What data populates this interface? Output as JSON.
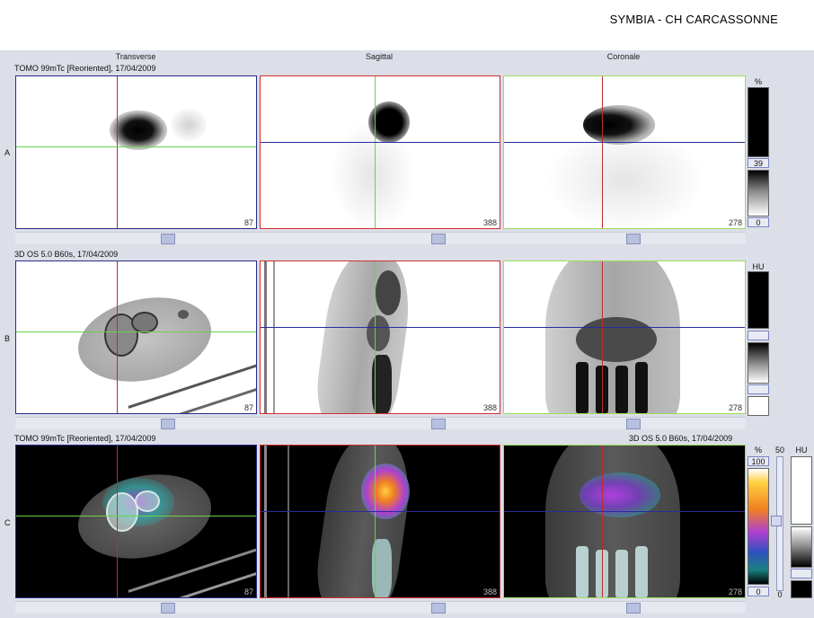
{
  "header": {
    "title": "SYMBIA - CH CARCASSONNE"
  },
  "columns": {
    "transverse": "Transverse",
    "sagittal": "Sagittal",
    "coronal": "Coronale"
  },
  "rows": {
    "a": {
      "letter": "A",
      "series": "TOMO 99mTc [Reoriented], 17/04/2009",
      "scale_unit": "%",
      "scale_max": "39",
      "scale_min": "0"
    },
    "b": {
      "letter": "B",
      "series": "3D  OS  5.0  B60s, 17/04/2009",
      "scale_unit": "HU"
    },
    "c": {
      "letter": "C",
      "series_left": "TOMO 99mTc [Reoriented], 17/04/2009",
      "series_right": "3D  OS  5.0  B60s, 17/04/2009",
      "scale_unit_pct": "%",
      "scale_max_pct": "100",
      "scale_min_pct": "0",
      "fusion_value": "50",
      "fusion_min": "0",
      "scale_unit_hu": "HU"
    }
  },
  "slices": {
    "transverse": "87",
    "sagittal": "388",
    "coronal": "278"
  },
  "colors": {
    "sagittal_border": "#d03030",
    "coronal_border": "#9cdc5c",
    "transverse_border": "#2a2a8a",
    "crosshair_green": "#6ad24a",
    "crosshair_red": "#c02a2a",
    "crosshair_blue": "#2a2aa0"
  }
}
